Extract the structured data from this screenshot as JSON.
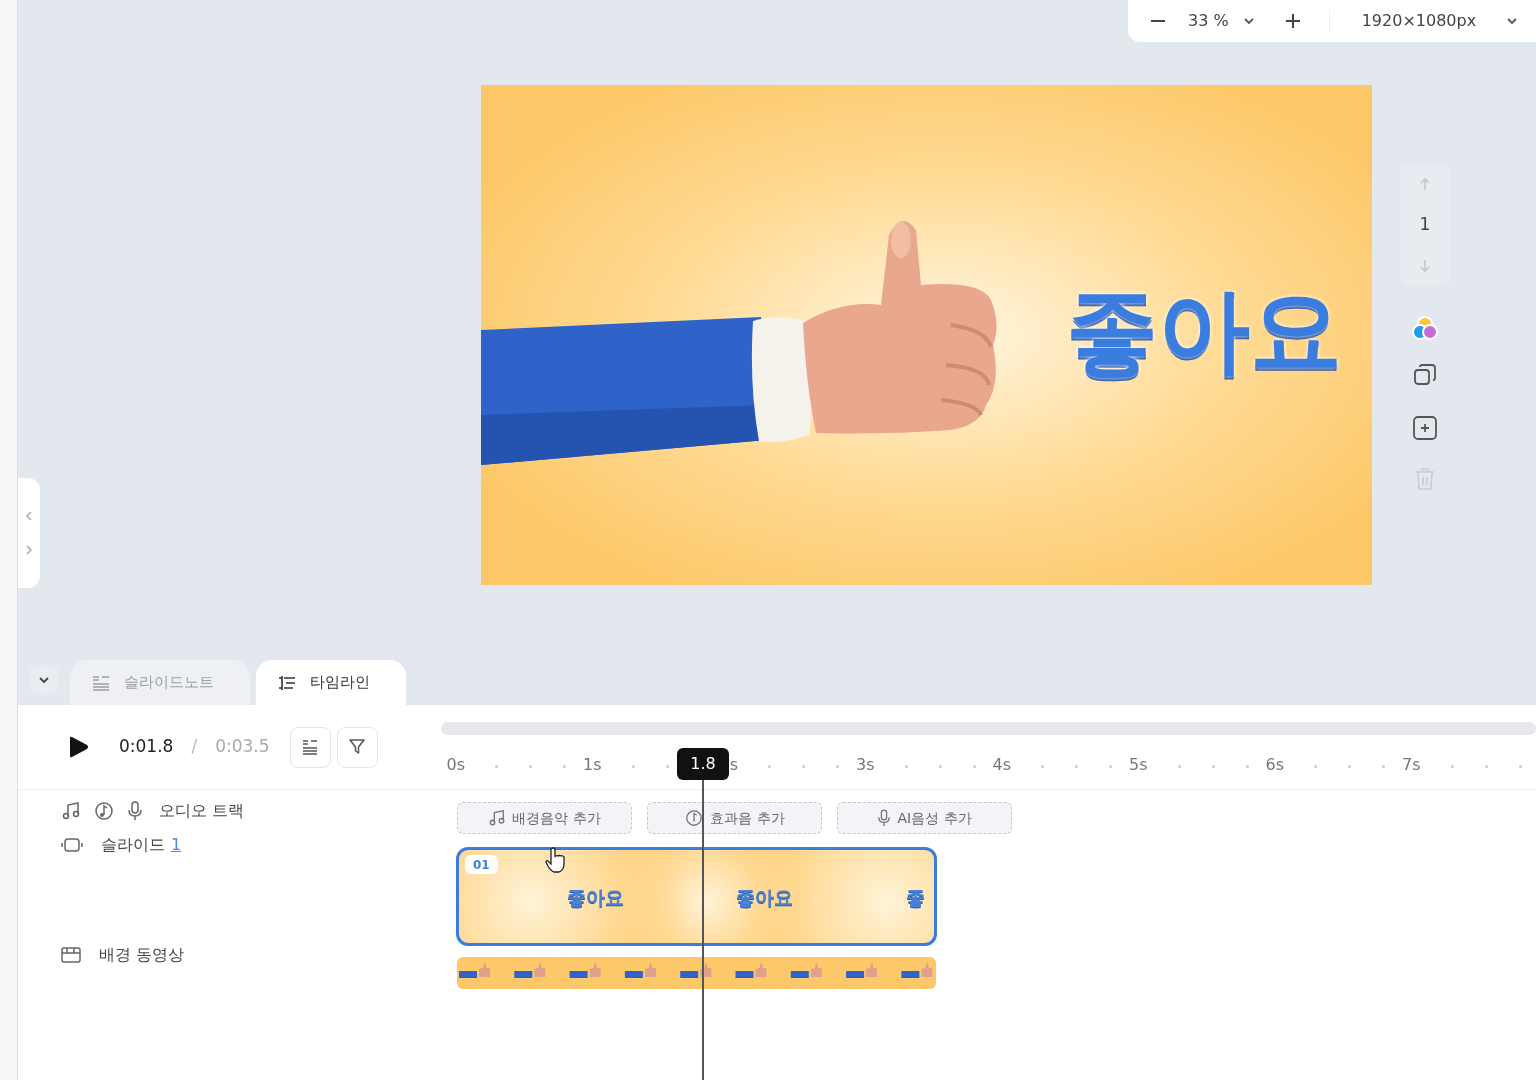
{
  "toolbar": {
    "zoom": "33 %",
    "resolution": "1920×1080px"
  },
  "slide": {
    "headline": "좋아요"
  },
  "slide_nav": {
    "page": "1"
  },
  "panel_tabs": [
    {
      "label": "슬라이드노트",
      "selected": false
    },
    {
      "label": "타임라인",
      "selected": true
    }
  ],
  "playback": {
    "current": "0:01.8",
    "separator": "/",
    "total": "0:03.5"
  },
  "ruler": {
    "ticks": [
      "0s",
      "1s",
      "s",
      "3s",
      "4s",
      "5s",
      "6s",
      "7s"
    ],
    "playhead": "1.8"
  },
  "tracks": {
    "audio": {
      "label": "오디오 트랙",
      "buttons": [
        "배경음악 추가",
        "효과음 추가",
        "AI음성 추가"
      ]
    },
    "slide": {
      "label": "슬라이드",
      "count": "1",
      "clip": {
        "badge": "01",
        "captions": [
          "좋아요",
          "좋아요",
          "좋"
        ]
      }
    },
    "background": {
      "label": "배경 동영상"
    }
  }
}
